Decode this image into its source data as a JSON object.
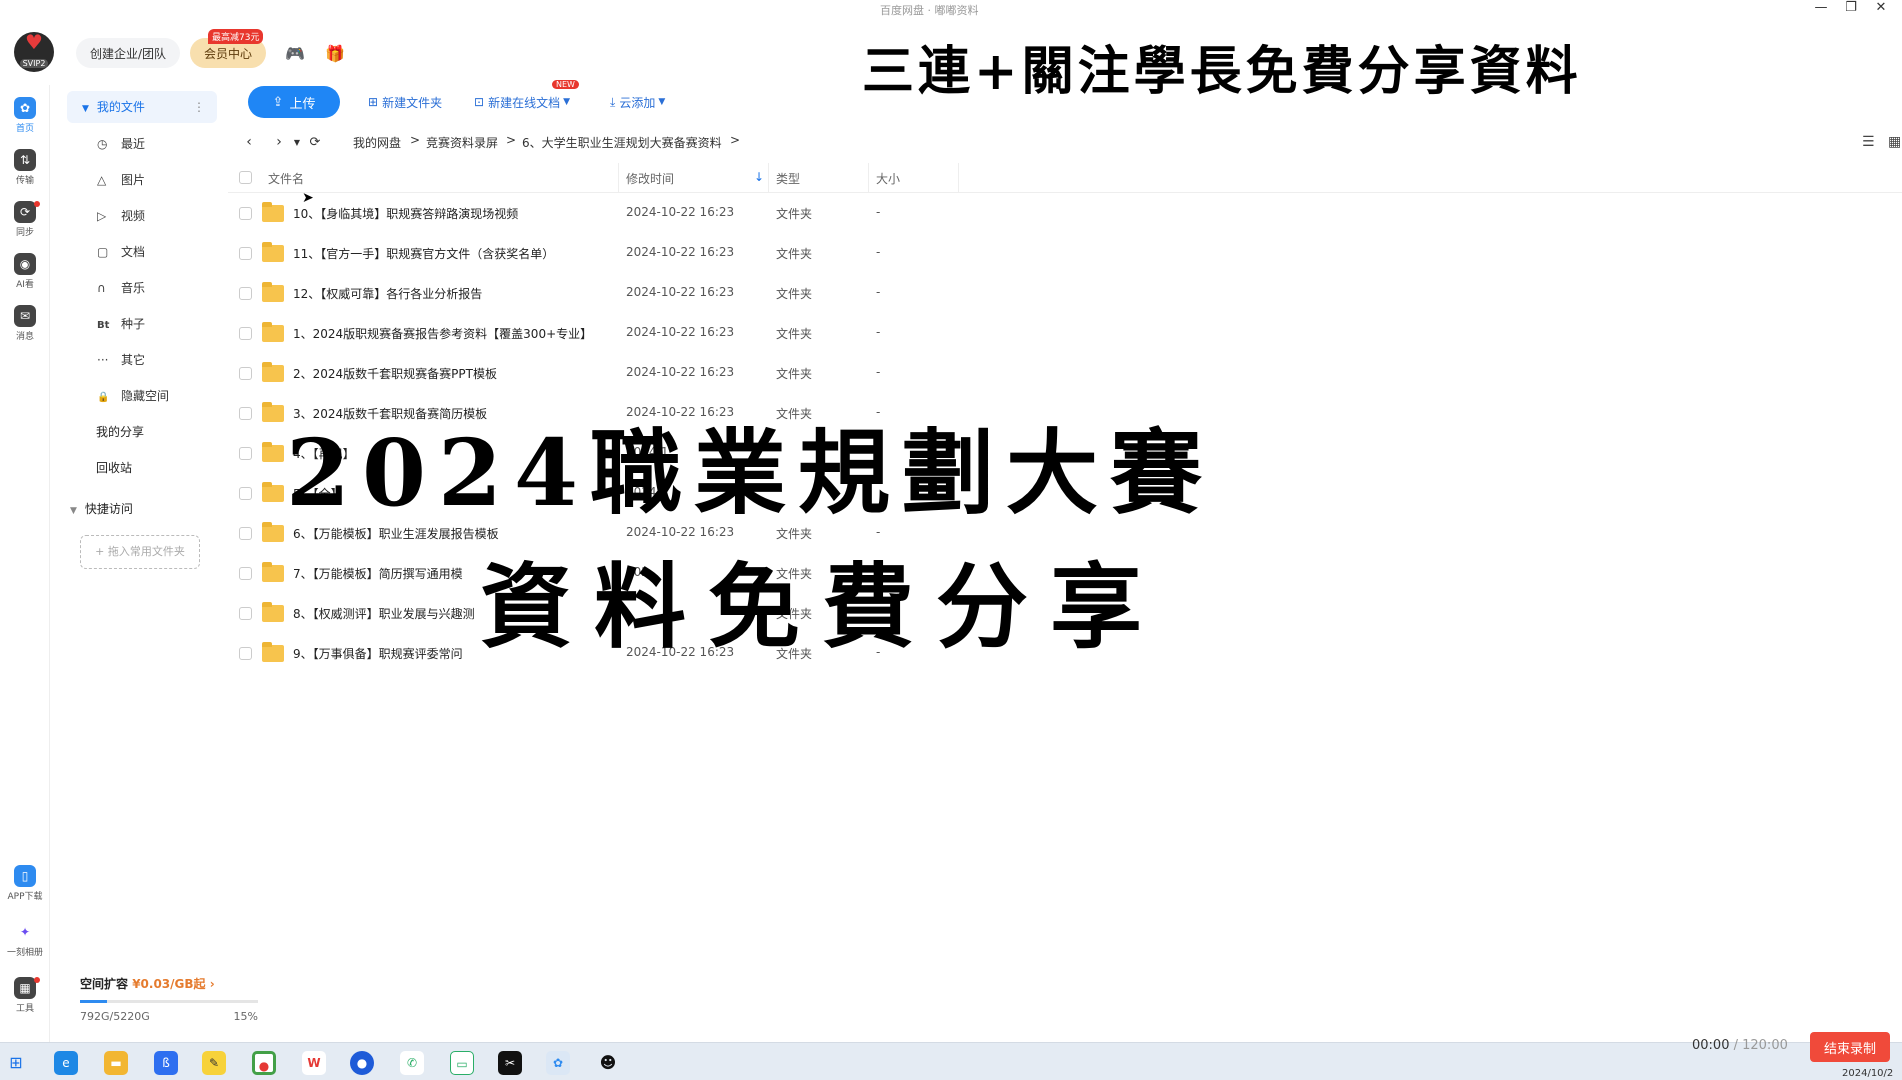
{
  "window": {
    "title": "百度网盘 · 嘟嘟资料",
    "controls": [
      "—",
      "❐",
      "✕"
    ]
  },
  "header": {
    "logo_label": "SVIP2",
    "enterprise_label": "创建企业/团队",
    "vip_label": "会员中心",
    "vip_badge": "最高减73元",
    "banner": "三連+關注學長免費分享資料"
  },
  "rail": [
    {
      "name": "home",
      "label": "首页",
      "icon": "home-icon",
      "glyph": "✿"
    },
    {
      "name": "transfer",
      "label": "传输",
      "icon": "transfer-icon",
      "glyph": "⇅"
    },
    {
      "name": "sync",
      "label": "同步",
      "icon": "sync-icon",
      "glyph": "⟳"
    },
    {
      "name": "ai",
      "label": "AI看",
      "icon": "ai-icon",
      "glyph": "◉"
    },
    {
      "name": "message",
      "label": "消息",
      "icon": "message-icon",
      "glyph": "✉"
    }
  ],
  "rail_bottom": [
    {
      "name": "app-download",
      "label": "APP下载",
      "icon": "phone-icon",
      "glyph": "▯"
    },
    {
      "name": "yike",
      "label": "一刻相册",
      "icon": "album-icon",
      "glyph": "✦"
    },
    {
      "name": "tools",
      "label": "工具",
      "icon": "tools-icon",
      "glyph": "▦"
    }
  ],
  "sidebar": {
    "my_files": "我的文件",
    "items": [
      {
        "label": "最近",
        "icon": "clock-icon",
        "glyph": "◷"
      },
      {
        "label": "图片",
        "icon": "image-icon",
        "glyph": "△"
      },
      {
        "label": "视频",
        "icon": "video-icon",
        "glyph": "▷"
      },
      {
        "label": "文档",
        "icon": "document-icon",
        "glyph": "▢"
      },
      {
        "label": "音乐",
        "icon": "headphone-icon",
        "glyph": "∩"
      },
      {
        "label": "种子",
        "icon": "torrent-icon",
        "glyph": "Bt"
      },
      {
        "label": "其它",
        "icon": "more-icon",
        "glyph": "···"
      },
      {
        "label": "隐藏空间",
        "icon": "lock-icon",
        "glyph": "🔒"
      }
    ],
    "my_share": "我的分享",
    "recycle": "回收站",
    "quick_access": "快捷访问",
    "drop_hint": "+ 拖入常用文件夹",
    "space_title": "空间扩容",
    "space_price": "¥0.03/GB起",
    "space_used": "792G/5220G",
    "space_pct": "15%",
    "space_fraction": 0.15
  },
  "toolbar": {
    "upload": "上传",
    "new_folder": "新建文件夹",
    "new_online_doc": "新建在线文档",
    "new_badge": "NEW",
    "cloud_add": "云添加"
  },
  "breadcrumb": [
    "我的网盘",
    "竞赛资料录屏",
    "6、大学生职业生涯规划大赛备赛资料"
  ],
  "table": {
    "headers": {
      "name": "文件名",
      "modified": "修改时间",
      "type": "类型",
      "size": "大小"
    },
    "rows": [
      {
        "name": "10、【身临其境】职规赛答辩路演现场视频",
        "date": "2024-10-22 16:23",
        "type": "文件夹",
        "size": "-"
      },
      {
        "name": "11、【官方一手】职规赛官方文件（含获奖名单）",
        "date": "2024-10-22 16:23",
        "type": "文件夹",
        "size": "-"
      },
      {
        "name": "12、【权威可靠】各行各业分析报告",
        "date": "2024-10-22 16:23",
        "type": "文件夹",
        "size": "-"
      },
      {
        "name": "1、2024版职规赛备赛报告参考资料【覆盖300+专业】",
        "date": "2024-10-22 16:23",
        "type": "文件夹",
        "size": "-"
      },
      {
        "name": "2、2024版数千套职规赛备赛PPT模板",
        "date": "2024-10-22 16:23",
        "type": "文件夹",
        "size": "-"
      },
      {
        "name": "3、2024版数千套职规备赛简历模板",
        "date": "2024-10-22 16:23",
        "type": "文件夹",
        "size": "-"
      },
      {
        "name": "4、【再现】",
        "date": "2024-1",
        "type": "",
        "size": ""
      },
      {
        "name": "5、【全】",
        "date": "2024",
        "type": "",
        "size": ""
      },
      {
        "name": "6、【万能模板】职业生涯发展报告模板",
        "date": "2024-10-22 16:23",
        "type": "文件夹",
        "size": "-"
      },
      {
        "name": "7、【万能模板】简历撰写通用模",
        "date": "202",
        "type": "文件夹",
        "size": "-"
      },
      {
        "name": "8、【权威测评】职业发展与兴趣测",
        "date": "",
        "type": "文件夹",
        "size": "-"
      },
      {
        "name": "9、【万事俱备】职规赛评委常问",
        "date": "2024-10-22 16:23",
        "type": "文件夹",
        "size": "-"
      }
    ]
  },
  "overlay": {
    "line1": "2024職業規劃大賽",
    "line2": "資料免費分享"
  },
  "recorder": {
    "elapsed": "00:00",
    "total": "/ 120:00",
    "stop": "结束录制"
  },
  "tray_date": "2024/10/2"
}
